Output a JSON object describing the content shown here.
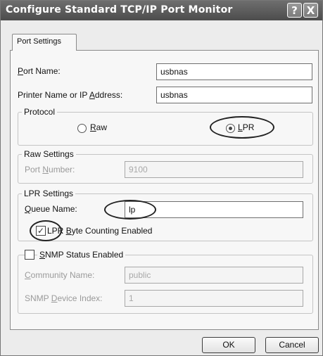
{
  "window": {
    "title": "Configure Standard TCP/IP Port Monitor",
    "help_glyph": "?",
    "close_glyph": "X"
  },
  "tab": {
    "label": "Port Settings"
  },
  "port_name": {
    "label_pre": "",
    "label_key": "P",
    "label_post": "ort Name:",
    "value": "usbnas"
  },
  "printer_address": {
    "label_pre": "Printer Name or IP ",
    "label_key": "A",
    "label_post": "ddress:",
    "value": "usbnas"
  },
  "protocol": {
    "title": "Protocol",
    "raw": {
      "key": "R",
      "rest": "aw",
      "selected": false
    },
    "lpr": {
      "key": "L",
      "rest": "PR",
      "selected": true
    }
  },
  "raw_settings": {
    "title": "Raw Settings",
    "port_label_pre": "Port ",
    "port_label_key": "N",
    "port_label_post": "umber:",
    "port_value": "9100"
  },
  "lpr_settings": {
    "title": "LPR Settings",
    "queue_key": "Q",
    "queue_rest": "ueue Name:",
    "queue_value": "lp",
    "byte_count_pre": "LPR ",
    "byte_count_key": "B",
    "byte_count_post": "yte Counting Enabled",
    "byte_count_checked": true
  },
  "snmp": {
    "label_key": "S",
    "label_rest": "NMP Status Enabled",
    "checked": false,
    "community_key": "C",
    "community_rest": "ommunity Name:",
    "community_value": "public",
    "device_pre": "SNMP ",
    "device_key": "D",
    "device_post": "evice Index:",
    "device_value": "1"
  },
  "buttons": {
    "ok": "OK",
    "cancel": "Cancel"
  }
}
